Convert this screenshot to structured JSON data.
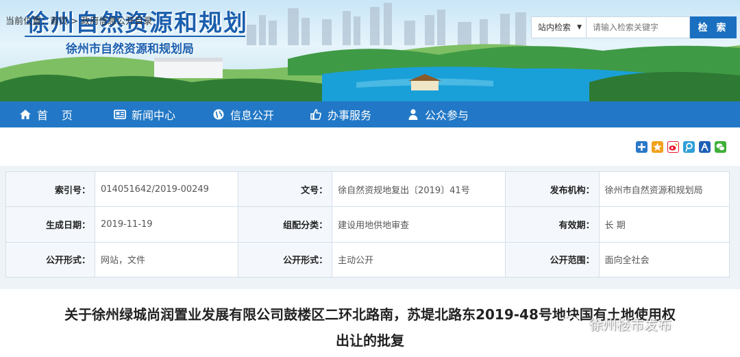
{
  "header": {
    "logo_title": "徐州自然资源和规划",
    "logo_subtitle": "徐州市自然资源和规划局"
  },
  "search": {
    "scope_label": "站内检索",
    "placeholder": "请输入检索关键字",
    "button_label": "检 索"
  },
  "nav": {
    "items": [
      {
        "label": "首页",
        "icon": "home-icon"
      },
      {
        "label": "新闻中心",
        "icon": "newspaper-icon"
      },
      {
        "label": "信息公开",
        "icon": "globe-icon"
      },
      {
        "label": "办事服务",
        "icon": "thumbs-up-icon"
      },
      {
        "label": "公众参与",
        "icon": "user-icon"
      }
    ]
  },
  "breadcrumb": {
    "prefix": "当前位置：",
    "home": "首页",
    "separator": " > ",
    "current": "政府信息公开目录"
  },
  "share_icons": [
    {
      "icon": "plus-share-icon",
      "color": "#2a78c8"
    },
    {
      "icon": "qzone-star-icon",
      "color": "#f0a21b"
    },
    {
      "icon": "weibo-icon",
      "color": "#e6162d"
    },
    {
      "icon": "tencent-weibo-icon",
      "color": "#2f9fd8"
    },
    {
      "icon": "renren-icon",
      "color": "#1f5fb5"
    },
    {
      "icon": "wechat-icon",
      "color": "#3fb038"
    }
  ],
  "meta": {
    "rows": [
      [
        {
          "key": "索引号：",
          "value": "014051642/2019-00249"
        },
        {
          "key": "文号：",
          "value": "徐自然资规地复出〔2019〕41号"
        },
        {
          "key": "发布机构：",
          "value": "徐州市自然资源和规划局"
        }
      ],
      [
        {
          "key": "生成日期：",
          "value": "2019-11-19"
        },
        {
          "key": "组配分类：",
          "value": "建设用地供地审查"
        },
        {
          "key": "有效期：",
          "value": "长 期"
        }
      ],
      [
        {
          "key": "公开形式：",
          "value": "网站，文件"
        },
        {
          "key": "公开形式：",
          "value": "主动公开"
        },
        {
          "key": "公开范围：",
          "value": "面向全社会"
        }
      ]
    ]
  },
  "document": {
    "title_line1": "关于徐州绿城尚润置业发展有限公司鼓楼区二环北路南，苏堤北路东2019-48号地块国有土地使用权",
    "title_line2": "出让的批复"
  },
  "watermark": {
    "text": "徐州楼市发布"
  }
}
